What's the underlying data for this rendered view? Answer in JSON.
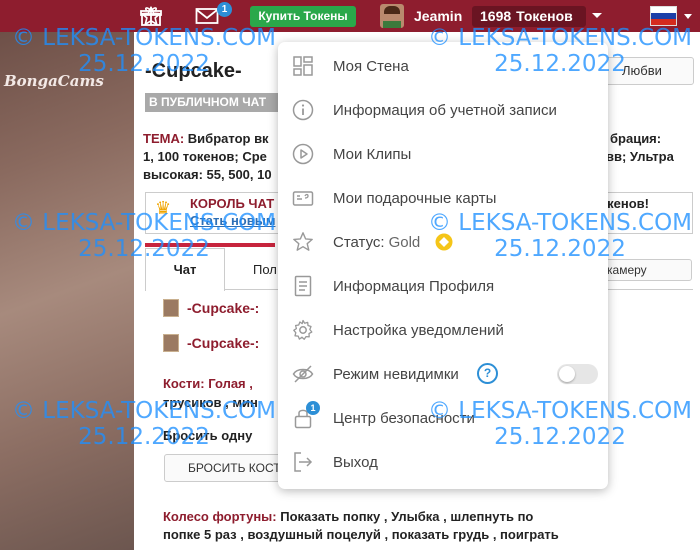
{
  "topbar": {
    "buy_tokens": "Купить Токены",
    "envelope_badge": "1",
    "username": "Jeamin",
    "tokens_count": "1698",
    "tokens_label": "Токенов",
    "flag_colors": [
      "#ffffff",
      "#1c3fa8",
      "#d52b1e"
    ]
  },
  "brand": "BongaCams",
  "room": {
    "title": "-Cupcake-",
    "love_button": "Любви",
    "public_chat": "В ПУБЛИЧНОМ ЧАТ",
    "topic_label": "ТЕМА:",
    "topic_line1a": "Вибратор вк",
    "topic_line1b": "брация:",
    "topic_line2a": "1, 100 токенов; Сре",
    "topic_line2b": "вв; Ультра",
    "topic_line3": "высокая: 55, 500, 10",
    "king_title": "КОРОЛЬ ЧАТ",
    "king_link": "Стать новым",
    "king_tail": "токенов!",
    "tab_chat": "Чат",
    "tab_second": "Пол",
    "cam_button": "камеру"
  },
  "chat": {
    "messages": [
      {
        "name": "-Cupcake-:"
      },
      {
        "name": "-Cupcake-:"
      }
    ],
    "dice_line1": "Кости: Голая ,",
    "dice_line2": "трусиков , мин",
    "throw_prompt": "Бросить одну",
    "throw_button": "БРОСИТЬ КОСТ",
    "wheel_label": "Колесо фортуны:",
    "wheel_text1": "Показать попку , Улыбка , шлепнуть по",
    "wheel_text2": "попке 5 раз , воздушный поцелуй , показать грудь , поиграть"
  },
  "menu": {
    "items": [
      {
        "label": "Моя Стена",
        "icon": "wall-icon"
      },
      {
        "label": "Информация об учетной записи",
        "icon": "info-icon"
      },
      {
        "label": "Мои Клипы",
        "icon": "play-icon"
      },
      {
        "label": "Мои подарочные карты",
        "icon": "gift-card-icon"
      },
      {
        "label": "Статус:",
        "icon": "star-icon",
        "value": "Gold"
      },
      {
        "label": "Информация Профиля",
        "icon": "profile-doc-icon"
      },
      {
        "label": "Настройка уведомлений",
        "icon": "gear-icon"
      },
      {
        "label": "Режим невидимки",
        "icon": "eye-slash-icon"
      },
      {
        "label": "Центр безопасности",
        "icon": "lock-icon",
        "badge": "1"
      },
      {
        "label": "Выход",
        "icon": "logout-icon"
      }
    ],
    "help_mark": "?",
    "invisible_mode_on": false
  },
  "watermark": {
    "site": "© LEKSA-TOKENS.COM",
    "date": "25.12.2022"
  },
  "colors": {
    "topbar": "#8e1d2e",
    "buy_button": "#2aa84a",
    "accent_blue": "#2d8fd6",
    "gold": "#f5c518",
    "watermark": "#1e90ff"
  }
}
